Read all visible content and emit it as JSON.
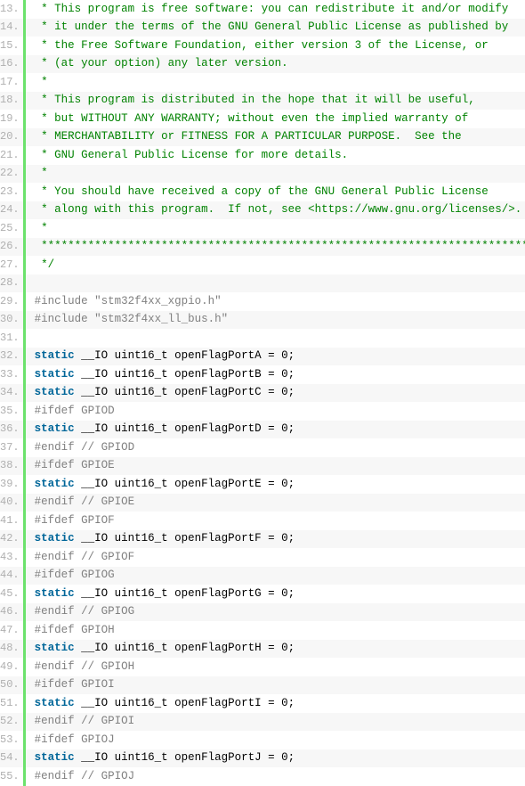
{
  "lines": [
    {
      "n": 13,
      "tokens": [
        {
          "c": "comment",
          "t": " * This program is free software: you can redistribute it and/or modify"
        }
      ]
    },
    {
      "n": 14,
      "tokens": [
        {
          "c": "comment",
          "t": " * it under the terms of the GNU General Public License as published by"
        }
      ]
    },
    {
      "n": 15,
      "tokens": [
        {
          "c": "comment",
          "t": " * the Free Software Foundation, either version 3 of the License, or"
        }
      ]
    },
    {
      "n": 16,
      "tokens": [
        {
          "c": "comment",
          "t": " * (at your option) any later version."
        }
      ]
    },
    {
      "n": 17,
      "tokens": [
        {
          "c": "comment",
          "t": " *"
        }
      ]
    },
    {
      "n": 18,
      "tokens": [
        {
          "c": "comment",
          "t": " * This program is distributed in the hope that it will be useful,"
        }
      ]
    },
    {
      "n": 19,
      "tokens": [
        {
          "c": "comment",
          "t": " * but WITHOUT ANY WARRANTY; without even the implied warranty of"
        }
      ]
    },
    {
      "n": 20,
      "tokens": [
        {
          "c": "comment",
          "t": " * MERCHANTABILITY or FITNESS FOR A PARTICULAR PURPOSE.  See the"
        }
      ]
    },
    {
      "n": 21,
      "tokens": [
        {
          "c": "comment",
          "t": " * GNU General Public License for more details."
        }
      ]
    },
    {
      "n": 22,
      "tokens": [
        {
          "c": "comment",
          "t": " *"
        }
      ]
    },
    {
      "n": 23,
      "tokens": [
        {
          "c": "comment",
          "t": " * You should have received a copy of the GNU General Public License"
        }
      ]
    },
    {
      "n": 24,
      "tokens": [
        {
          "c": "comment",
          "t": " * along with this program.  If not, see <https://www.gnu.org/licenses/>."
        }
      ]
    },
    {
      "n": 25,
      "tokens": [
        {
          "c": "comment",
          "t": " *"
        }
      ]
    },
    {
      "n": 26,
      "tokens": [
        {
          "c": "comment",
          "t": " ******************************************************************************"
        }
      ]
    },
    {
      "n": 27,
      "tokens": [
        {
          "c": "comment",
          "t": " */"
        }
      ]
    },
    {
      "n": 28,
      "tokens": []
    },
    {
      "n": 29,
      "tokens": [
        {
          "c": "preproc",
          "t": "#include \"stm32f4xx_xgpio.h\""
        }
      ]
    },
    {
      "n": 30,
      "tokens": [
        {
          "c": "preproc",
          "t": "#include \"stm32f4xx_ll_bus.h\""
        }
      ]
    },
    {
      "n": 31,
      "tokens": []
    },
    {
      "n": 32,
      "tokens": [
        {
          "c": "keyword",
          "t": "static"
        },
        {
          "c": "plain",
          "t": " __IO uint16_t openFlagPortA = 0;"
        }
      ]
    },
    {
      "n": 33,
      "tokens": [
        {
          "c": "keyword",
          "t": "static"
        },
        {
          "c": "plain",
          "t": " __IO uint16_t openFlagPortB = 0;"
        }
      ]
    },
    {
      "n": 34,
      "tokens": [
        {
          "c": "keyword",
          "t": "static"
        },
        {
          "c": "plain",
          "t": " __IO uint16_t openFlagPortC = 0;"
        }
      ]
    },
    {
      "n": 35,
      "tokens": [
        {
          "c": "preproc",
          "t": "#ifdef GPIOD"
        }
      ]
    },
    {
      "n": 36,
      "tokens": [
        {
          "c": "keyword",
          "t": "static"
        },
        {
          "c": "plain",
          "t": " __IO uint16_t openFlagPortD = 0;"
        }
      ]
    },
    {
      "n": 37,
      "tokens": [
        {
          "c": "preproc",
          "t": "#endif // GPIOD"
        }
      ]
    },
    {
      "n": 38,
      "tokens": [
        {
          "c": "preproc",
          "t": "#ifdef GPIOE"
        }
      ]
    },
    {
      "n": 39,
      "tokens": [
        {
          "c": "keyword",
          "t": "static"
        },
        {
          "c": "plain",
          "t": " __IO uint16_t openFlagPortE = 0;"
        }
      ]
    },
    {
      "n": 40,
      "tokens": [
        {
          "c": "preproc",
          "t": "#endif // GPIOE"
        }
      ]
    },
    {
      "n": 41,
      "tokens": [
        {
          "c": "preproc",
          "t": "#ifdef GPIOF"
        }
      ]
    },
    {
      "n": 42,
      "tokens": [
        {
          "c": "keyword",
          "t": "static"
        },
        {
          "c": "plain",
          "t": " __IO uint16_t openFlagPortF = 0;"
        }
      ]
    },
    {
      "n": 43,
      "tokens": [
        {
          "c": "preproc",
          "t": "#endif // GPIOF"
        }
      ]
    },
    {
      "n": 44,
      "tokens": [
        {
          "c": "preproc",
          "t": "#ifdef GPIOG"
        }
      ]
    },
    {
      "n": 45,
      "tokens": [
        {
          "c": "keyword",
          "t": "static"
        },
        {
          "c": "plain",
          "t": " __IO uint16_t openFlagPortG = 0;"
        }
      ]
    },
    {
      "n": 46,
      "tokens": [
        {
          "c": "preproc",
          "t": "#endif // GPIOG"
        }
      ]
    },
    {
      "n": 47,
      "tokens": [
        {
          "c": "preproc",
          "t": "#ifdef GPIOH"
        }
      ]
    },
    {
      "n": 48,
      "tokens": [
        {
          "c": "keyword",
          "t": "static"
        },
        {
          "c": "plain",
          "t": " __IO uint16_t openFlagPortH = 0;"
        }
      ]
    },
    {
      "n": 49,
      "tokens": [
        {
          "c": "preproc",
          "t": "#endif // GPIOH"
        }
      ]
    },
    {
      "n": 50,
      "tokens": [
        {
          "c": "preproc",
          "t": "#ifdef GPIOI"
        }
      ]
    },
    {
      "n": 51,
      "tokens": [
        {
          "c": "keyword",
          "t": "static"
        },
        {
          "c": "plain",
          "t": " __IO uint16_t openFlagPortI = 0;"
        }
      ]
    },
    {
      "n": 52,
      "tokens": [
        {
          "c": "preproc",
          "t": "#endif // GPIOI"
        }
      ]
    },
    {
      "n": 53,
      "tokens": [
        {
          "c": "preproc",
          "t": "#ifdef GPIOJ"
        }
      ]
    },
    {
      "n": 54,
      "tokens": [
        {
          "c": "keyword",
          "t": "static"
        },
        {
          "c": "plain",
          "t": " __IO uint16_t openFlagPortJ = 0;"
        }
      ]
    },
    {
      "n": 55,
      "tokens": [
        {
          "c": "preproc",
          "t": "#endif // GPIOJ"
        }
      ]
    }
  ]
}
